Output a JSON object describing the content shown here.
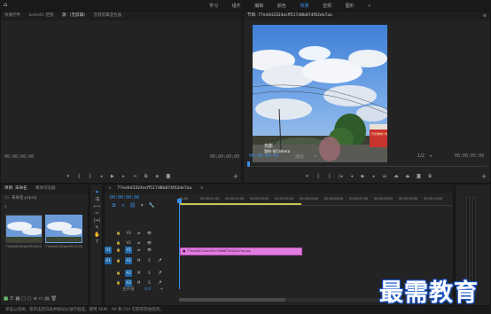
{
  "top_nav": {
    "items": [
      "学习",
      "组件",
      "编辑",
      "颜色",
      "效果",
      "音频",
      "图形"
    ],
    "active_index": 4
  },
  "source_panel": {
    "tabs": [
      "效果控件",
      "Lumetri 范围",
      "源：(无剪辑)",
      "音频剪辑混合器"
    ],
    "active_index": 2,
    "timecode_left": "00;00;00;00",
    "timecode_right": "00;00;00;00"
  },
  "program": {
    "title": "节目: 77ed4d3324ecff517d8b874f42de7aa",
    "timecode": "00:00:00:00",
    "fit": "适合",
    "ratio": "1/2",
    "duration": "00:00:05:00",
    "watermark_line1": "光影",
    "watermark_line2": "我的-张Camera",
    "billboard": "开泰购物广场"
  },
  "project_panel": {
    "tabs": [
      "项目: 未命名",
      "媒体浏览器"
    ],
    "path": "未命名.prproj",
    "items": [
      {
        "name": "77ed4d3324ecff51...",
        "dur": "5:00"
      },
      {
        "name": "77ed4d3324ecff51...",
        "dur": "5:00"
      }
    ]
  },
  "timeline": {
    "tab": "77ed4d3324ecff517d8b874f42de7aa",
    "timecode": "00:00:00:00",
    "ruler": [
      "00:00",
      "00:00:01:00",
      "00:00:02:00",
      "00:00:03:00",
      "00:00:04:00",
      "00:00:05:00",
      "00:00:06:00",
      "00:00:07:00",
      "00:00:08:00",
      "00:00:09:00",
      "00:00:10:00"
    ],
    "video_tracks": [
      "V3",
      "V2",
      "V1"
    ],
    "audio_tracks": [
      "A1",
      "A2",
      "A3"
    ],
    "master_label": "主声道",
    "master_value": "0.0",
    "clip_label": "77ed4d3324ecff517d8b874f42de7aa.jpg",
    "clip_color": "#e17de0"
  },
  "status_bar": {
    "text": "单击以选择，或单击空白处并拖动以进行框选。使用 Shift、Alt 和 Ctrl 可获得其他选项。"
  },
  "brand_watermark": "最需教育",
  "colors": {
    "accent_blue": "#3d8ee8",
    "clip_pink": "#e17de0",
    "track_button_blue": "#1f67a6"
  }
}
